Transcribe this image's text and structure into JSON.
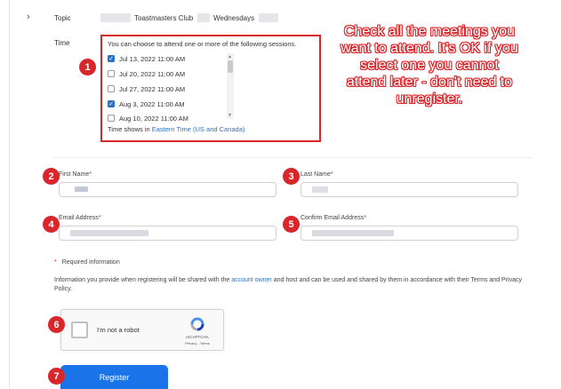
{
  "form": {
    "topic_label": "Topic",
    "topic_club": "Toastmasters Club",
    "topic_day": "Wednesdays",
    "time_label": "Time",
    "sessions_intro": "You can choose to attend one or more of the following sessions.",
    "sessions": [
      {
        "label": "Jul 13, 2022 11:00 AM",
        "checked": true
      },
      {
        "label": "Jul 20, 2022 11:00 AM",
        "checked": false
      },
      {
        "label": "Jul 27, 2022 11:00 AM",
        "checked": false
      },
      {
        "label": "Aug 3, 2022 11:00 AM",
        "checked": true
      },
      {
        "label": "Aug 10, 2022 11:00 AM",
        "checked": false
      }
    ],
    "timezone_prefix": "Time shows in",
    "timezone_link": "Eastern Time (US and Canada)",
    "first_name_label": "First Name",
    "last_name_label": "Last Name",
    "email_label": "Email Address",
    "confirm_email_label": "Confirm Email Address",
    "required_star": "*",
    "required_info": "Required information",
    "privacy_part1": "Information you provide when registering will be shared with the",
    "privacy_link": "account owner",
    "privacy_part2": "and host and can be used and shared by them in accordance with their Terms and Privacy Policy.",
    "captcha_label": "I'm not a robot",
    "captcha_brand": "reCAPTCHA",
    "captcha_terms": "Privacy - Terms",
    "register_label": "Register"
  },
  "annotation": {
    "text": "Check all the meetings you want to attend. It's OK if you select one you cannot attend later - don't need to unregister."
  },
  "badges": [
    "1",
    "2",
    "3",
    "4",
    "5",
    "6",
    "7"
  ],
  "colors": {
    "accent_red": "#d9262b",
    "link_blue": "#2d72c8",
    "button_blue": "#1a73e8"
  }
}
